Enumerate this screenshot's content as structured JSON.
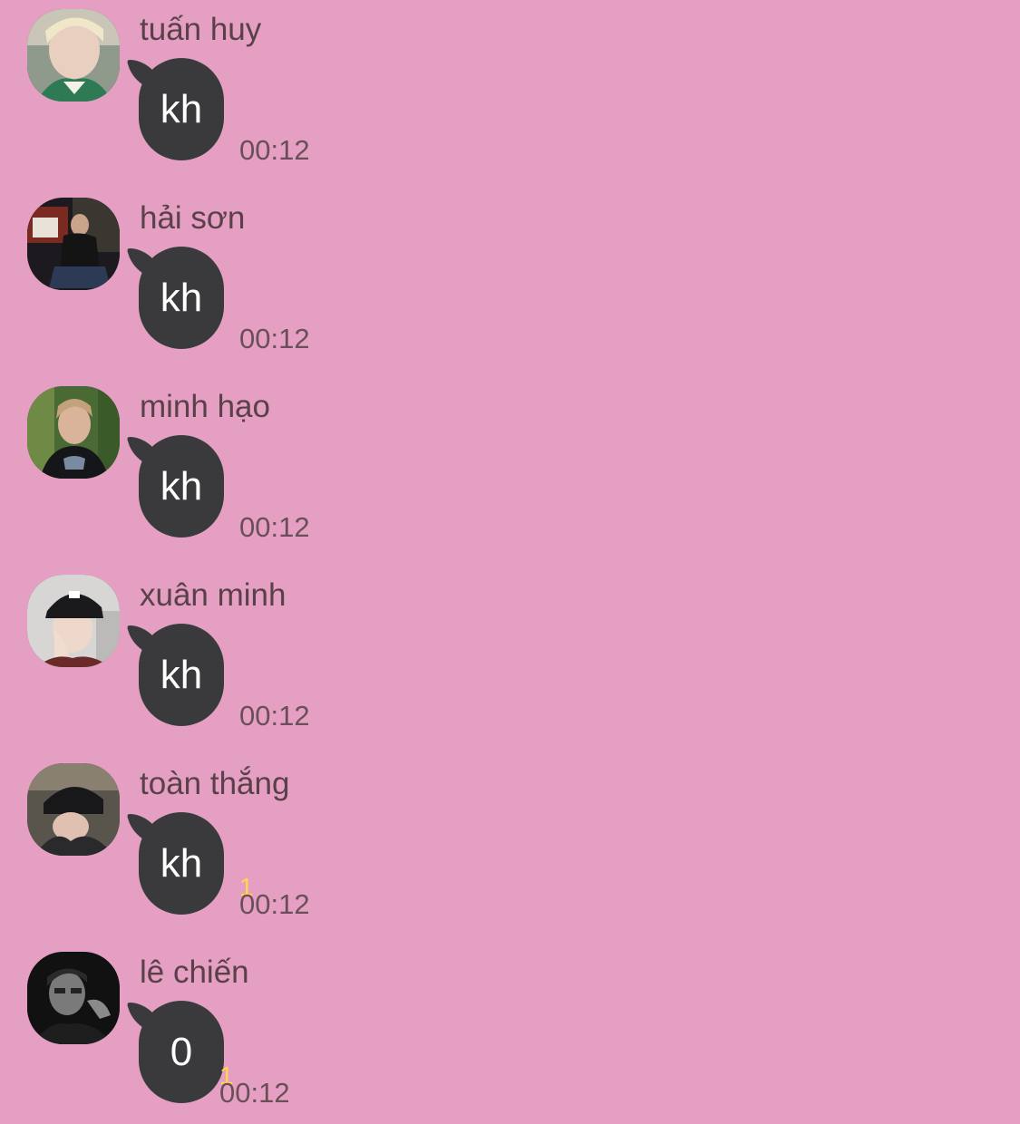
{
  "messages": [
    {
      "sender": "tuấn huy",
      "text": "kh",
      "time": "00:12",
      "unread": "",
      "avatar": "avatar-1"
    },
    {
      "sender": "hải sơn",
      "text": "kh",
      "time": "00:12",
      "unread": "",
      "avatar": "avatar-2"
    },
    {
      "sender": "minh hạo",
      "text": "kh",
      "time": "00:12",
      "unread": "",
      "avatar": "avatar-3"
    },
    {
      "sender": "xuân minh",
      "text": "kh",
      "time": "00:12",
      "unread": "",
      "avatar": "avatar-4"
    },
    {
      "sender": "toàn thắng",
      "text": "kh",
      "time": "00:12",
      "unread": "1",
      "avatar": "avatar-5"
    },
    {
      "sender": "lê chiến",
      "text": "0",
      "time": "00:12",
      "unread": "1",
      "avatar": "avatar-6"
    }
  ],
  "colors": {
    "background": "#e59fc2",
    "bubble": "#3a3a3c",
    "bubble_text": "#ffffff",
    "unread": "#ffd94a",
    "meta_text": "#6a4f58"
  }
}
